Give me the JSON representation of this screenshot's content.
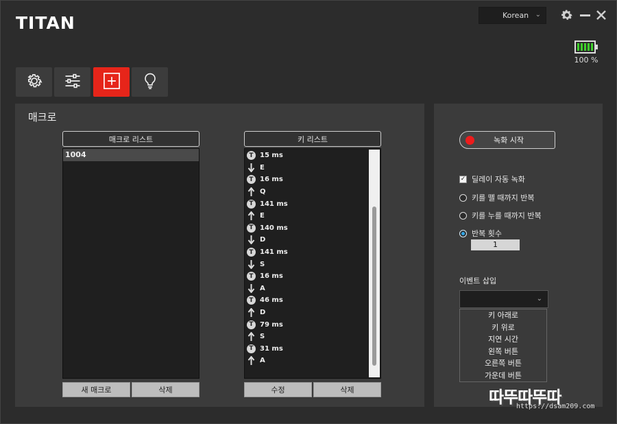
{
  "app": {
    "title": "TITAN"
  },
  "language": {
    "selected": "Korean"
  },
  "battery": {
    "level_text": "100 %",
    "level": 1.0
  },
  "tabs": [
    {
      "name": "settings",
      "icon": "gear-icon"
    },
    {
      "name": "sliders",
      "icon": "sliders-icon"
    },
    {
      "name": "macro",
      "icon": "plus-square-icon",
      "active": true
    },
    {
      "name": "light",
      "icon": "lightbulb-icon"
    }
  ],
  "macro_panel": {
    "title": "매크로",
    "macro_list_header": "매크로 리스트",
    "macro_items": [
      "1004"
    ],
    "new_macro_label": "새 매크로",
    "delete_label": "삭제",
    "key_list_header": "키 리스트",
    "key_items": [
      {
        "type": "time",
        "text": "15 ms"
      },
      {
        "type": "down",
        "text": "E"
      },
      {
        "type": "time",
        "text": "16 ms"
      },
      {
        "type": "up",
        "text": "Q"
      },
      {
        "type": "time",
        "text": "141 ms"
      },
      {
        "type": "up",
        "text": "E"
      },
      {
        "type": "time",
        "text": "140 ms"
      },
      {
        "type": "down",
        "text": "D"
      },
      {
        "type": "time",
        "text": "141 ms"
      },
      {
        "type": "down",
        "text": "S"
      },
      {
        "type": "time",
        "text": "16 ms"
      },
      {
        "type": "down",
        "text": "A"
      },
      {
        "type": "time",
        "text": "46 ms"
      },
      {
        "type": "up",
        "text": "D"
      },
      {
        "type": "time",
        "text": "79 ms"
      },
      {
        "type": "up",
        "text": "S"
      },
      {
        "type": "time",
        "text": "31 ms"
      },
      {
        "type": "up",
        "text": "A"
      }
    ],
    "edit_label": "수정",
    "key_delete_label": "삭제"
  },
  "record_panel": {
    "record_label": "녹화 시작",
    "delay_auto_label": "딜레이 자동 녹화",
    "delay_auto_checked": true,
    "repeat_release_label": "키를 뗄 때까지 반복",
    "repeat_press_label": "키를 누를 때까지 반복",
    "repeat_count_label": "반복 횟수",
    "repeat_count_value": "1",
    "event_insert_label": "이벤트 삽입",
    "event_options": [
      "키 아래로",
      "키 위로",
      "지연 시간",
      "왼쪽 버튼",
      "오른쪽 버튼",
      "가운데 버튼"
    ]
  },
  "watermark": {
    "big": "따뚜따뚜따",
    "small": "https://dsam209.com"
  },
  "colors": {
    "accent": "#e6251a",
    "record_dot": "#ee1c1c",
    "battery": "#3ecf2b",
    "radio_on": "#30a6e8"
  }
}
